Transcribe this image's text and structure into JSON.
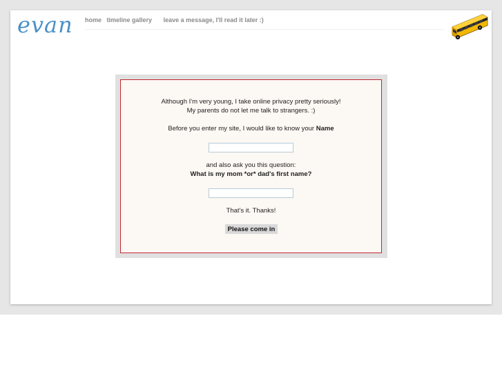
{
  "logo": "evan",
  "nav": {
    "items": [
      {
        "label": "home"
      },
      {
        "label": "timeline gallery"
      },
      {
        "label": "leave a message, I'll read it later :)"
      }
    ]
  },
  "gate": {
    "intro_line1": "Although I'm very young, I take online privacy pretty seriously!",
    "intro_line2": "My parents do not let me talk to strangers. :)",
    "name_prompt": "Before you enter my site, I would like to know your",
    "name_prompt_bold": "Name",
    "name_value": "",
    "question_intro": "and also ask you this question:",
    "question": "What is my mom *or* dad's first name?",
    "answer_value": "",
    "outro": "That's it. Thanks!",
    "submit_label": "Please come in"
  },
  "colors": {
    "logo": "#4a90c8",
    "gate_border": "#c0272d",
    "gate_background": "#fcf8f3"
  }
}
